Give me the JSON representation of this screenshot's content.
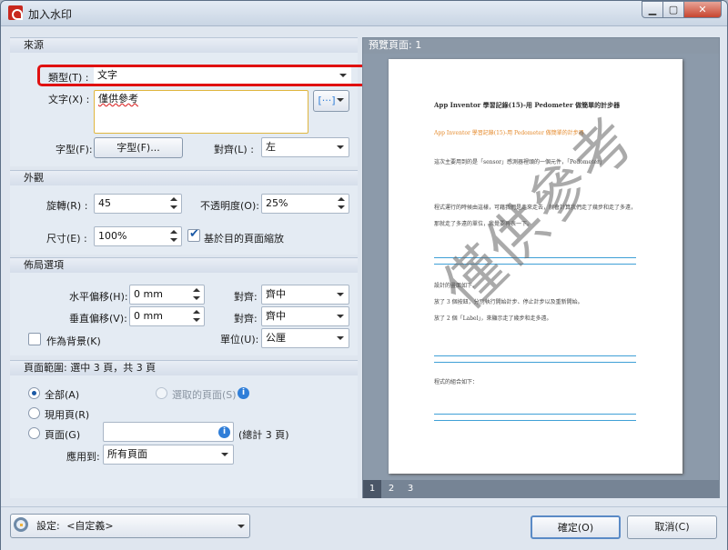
{
  "window": {
    "title": "加入水印",
    "min_label": "▁",
    "max_label": "▢",
    "close_label": "✕"
  },
  "source": {
    "header": "來源",
    "type_label": "類型(T) :",
    "type_value": "文字",
    "text_label": "文字(X) :",
    "text_value": "僅供參考",
    "insert_label": "[···]",
    "font_label": "字型(F):",
    "font_button": "字型(F)...",
    "align_label": "對齊(L) :",
    "align_value": "左"
  },
  "appearance": {
    "header": "外觀",
    "rotation_label": "旋轉(R) :",
    "rotation_value": "45",
    "opacity_label": "不透明度(O):",
    "opacity_value": "25%",
    "size_label": "尺寸(E) :",
    "size_value": "100%",
    "scale_label": "基於目的頁面縮放",
    "scale_checked": true
  },
  "layout": {
    "header": "佈局選項",
    "h_offset_label": "水平偏移(H):",
    "h_offset_value": "0 mm",
    "h_align_label": "對齊:",
    "h_align_value": "齊中",
    "v_offset_label": "垂直偏移(V):",
    "v_offset_value": "0 mm",
    "v_align_label": "對齊:",
    "v_align_value": "齊中",
    "background_label": "作為背景(K)",
    "unit_label": "單位(U):",
    "unit_value": "公厘"
  },
  "range": {
    "header": "頁面範圍: 選中 3 頁，共 3 頁",
    "all_label": "全部(A)",
    "selected_label": "選取的頁面(S)",
    "current_label": "現用頁(R)",
    "pages_label": "頁面(G)",
    "total_label": "(總計 3 頁)",
    "apply_label": "應用到:",
    "apply_value": "所有頁面"
  },
  "preview": {
    "header": "預覽頁面: 1",
    "watermark": "僅供參考",
    "doc_title": "App Inventor 學習記錄(15)-用 Pedometer 做簡單的計步器",
    "doc_lines": [
      "App Inventor 學習記錄(15)-用 Pedometer 做簡單的計步器",
      "這次主要用到的是「sensor」感測器裡頭的一個元件，「Pedometer」",
      "程式運行的時候由這樣，可藉我們是走來走去，就會計算我們走了幾步和走了多遠，",
      "那就走了多遠的單位，我覺要再表一下。",
      "設計的畫面如下。",
      "放了 3 個按鈕，分別執行開始計步、停止計步以及重新開始。",
      "放了 2 個「Label」，來顯示走了幾步和走多遠。",
      "程式的組合如下："
    ],
    "pages": [
      "1",
      "2",
      "3"
    ]
  },
  "footer": {
    "settings_label": "設定:",
    "settings_value": "<自定義>",
    "ok_label": "確定(O)",
    "cancel_label": "取消(C)"
  },
  "colors": {
    "highlight": "#e01010",
    "accent": "#2f7ed8"
  }
}
